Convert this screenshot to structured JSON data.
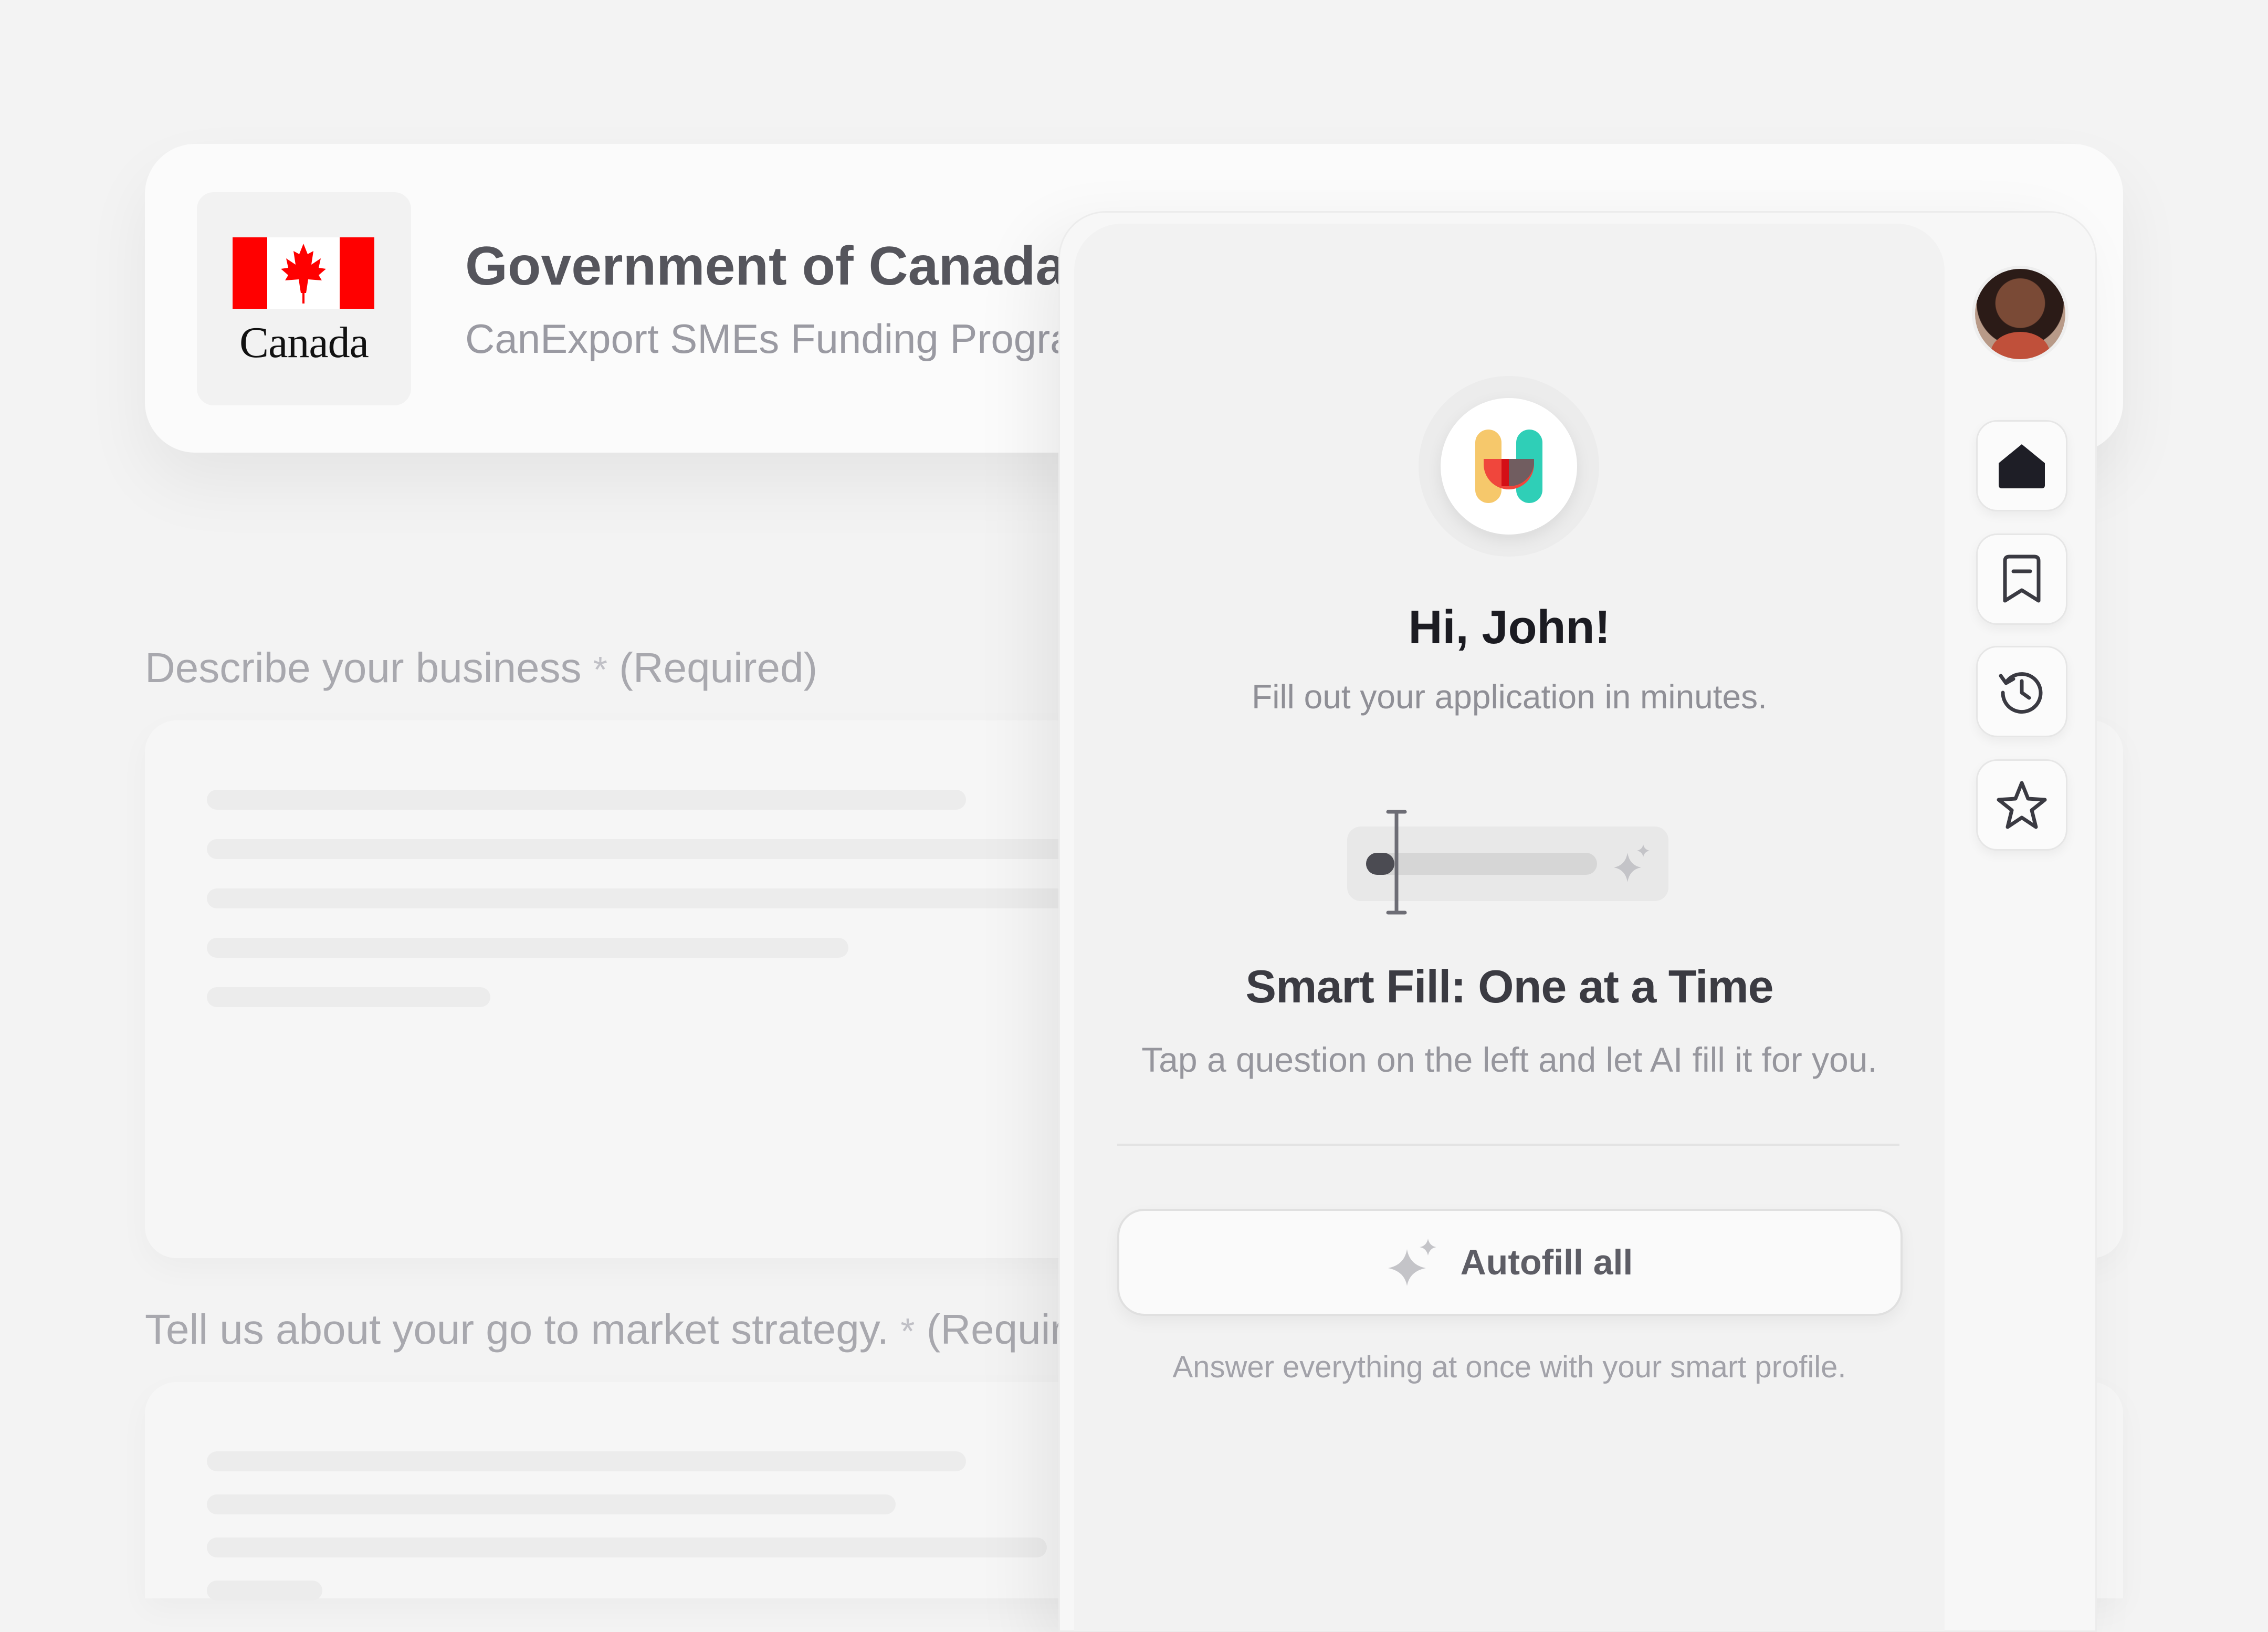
{
  "header": {
    "logo_wordmark": "Canada",
    "title": "Government of Canada",
    "subtitle": "CanExport SMEs Funding Program"
  },
  "form": {
    "questions": [
      {
        "label": "Describe your business",
        "required_mark": "*",
        "required_text": "(Required)"
      },
      {
        "label": "Tell us about your go to market strategy.",
        "required_mark": "*",
        "required_text": "(Required)"
      }
    ]
  },
  "assistant": {
    "greeting": "Hi, John!",
    "greeting_sub": "Fill out your application in minutes.",
    "feature_title": "Smart Fill: One at a Time",
    "feature_sub": "Tap a question on the left and let AI fill it for you.",
    "autofill_label": "Autofill all",
    "autofill_note": "Answer everything at once with your smart profile."
  },
  "sidebar": {
    "buttons": [
      {
        "icon": "home-icon"
      },
      {
        "icon": "bookmark-icon"
      },
      {
        "icon": "history-icon"
      },
      {
        "icon": "star-icon"
      }
    ]
  },
  "colors": {
    "flag_red": "#ff0000",
    "brand_yellow": "#f6c86b",
    "brand_teal": "#2fcfb7",
    "brand_red": "#f0463c",
    "text_dark": "#1c1c22"
  }
}
